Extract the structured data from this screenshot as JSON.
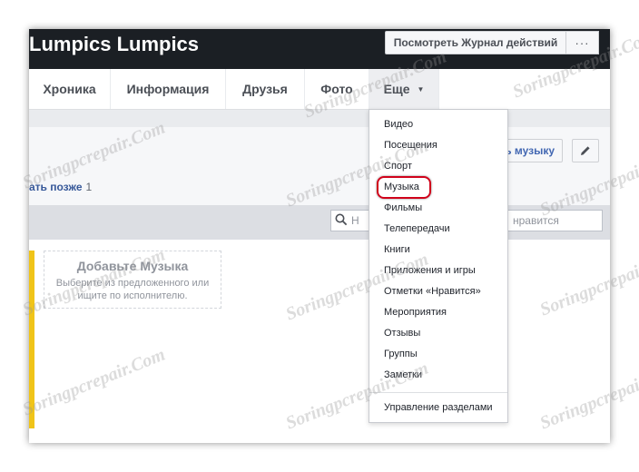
{
  "profile": {
    "name": "Lumpics Lumpics"
  },
  "header": {
    "activity_log_label": "Посмотреть Журнал действий",
    "more_label": "···"
  },
  "nav": {
    "tabs": [
      "Хроника",
      "Информация",
      "Друзья",
      "Фото"
    ],
    "more_label": "Еще",
    "caret": "▼"
  },
  "section": {
    "watch_later": "ать позже",
    "watch_later_count": "1",
    "add_music_label": "ь музыку"
  },
  "search": {
    "placeholder_left": "Н",
    "placeholder_right": "нравится"
  },
  "card": {
    "title": "Добавьте Музыка",
    "description": "Выберите из предложенного или ищите по исполнителю."
  },
  "menu": {
    "items": [
      "Видео",
      "Посещения",
      "Спорт",
      "Музыка",
      "Фильмы",
      "Телепередачи",
      "Книги",
      "Приложения и игры",
      "Отметки «Нравится»",
      "Мероприятия",
      "Отзывы",
      "Группы",
      "Заметки"
    ],
    "manage_label": "Управление разделами",
    "highlighted_index": 3
  },
  "watermark": {
    "text": "Soringpcrepair.Com"
  },
  "colors": {
    "highlight": "#d0021b",
    "cover": "#1b1f24",
    "link": "#365899",
    "accent": "#f0c419"
  }
}
